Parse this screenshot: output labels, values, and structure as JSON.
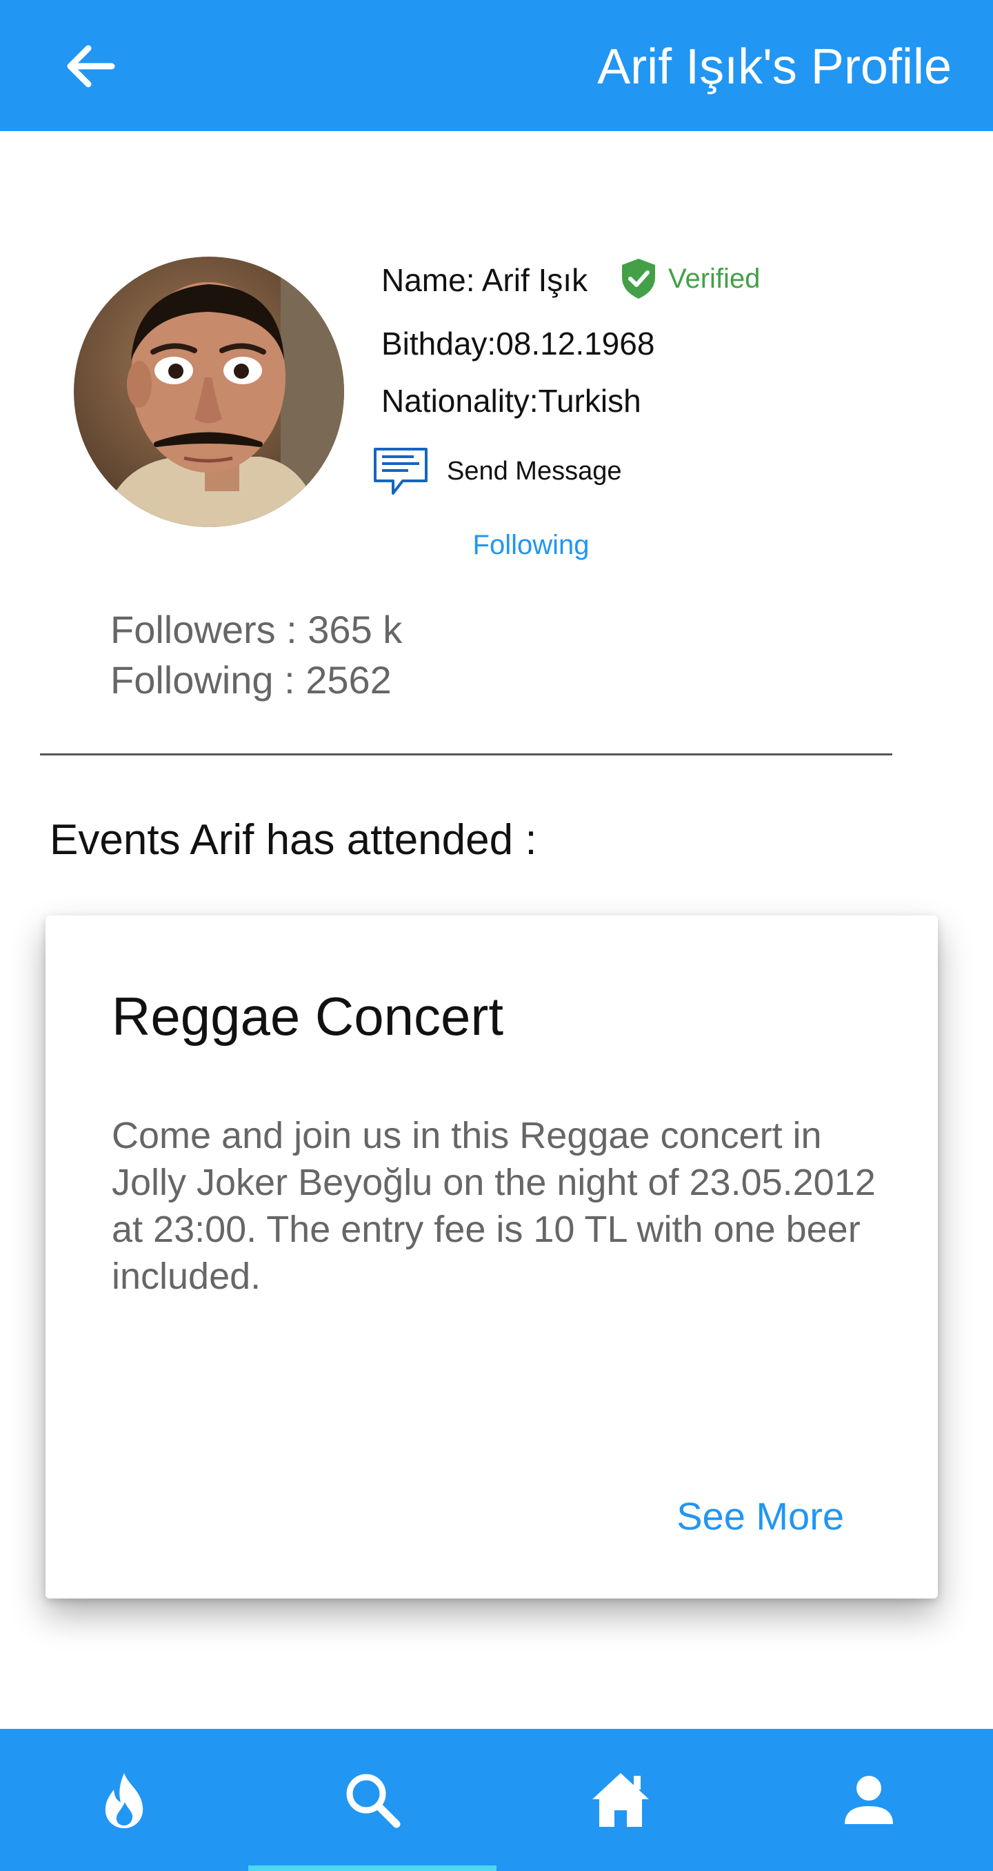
{
  "header": {
    "title": "Arif Işık's Profile",
    "back_icon": "arrow-left-icon"
  },
  "profile": {
    "name_line": "Name: Arif Işık",
    "verified_label": "Verified",
    "birthday_line": "Bithday:08.12.1968",
    "nationality_line": "Nationality:Turkish",
    "send_message_label": "Send Message",
    "following_button": "Following",
    "followers_line": "Followers : 365 k",
    "following_line": "Following : 2562"
  },
  "events": {
    "section_title": "Events Arif has attended :",
    "items": [
      {
        "title": "Reggae Concert",
        "description": "Come and join us in this Reggae concert in Jolly Joker Beyoğlu on the night of 23.05.2012 at 23:00. The entry fee is 10 TL with one beer included.",
        "see_more": "See More"
      }
    ]
  },
  "bottom_nav": {
    "items": [
      {
        "icon": "flame-icon"
      },
      {
        "icon": "search-icon",
        "selected": true
      },
      {
        "icon": "home-icon"
      },
      {
        "icon": "person-icon"
      }
    ]
  },
  "colors": {
    "primary": "#2196f3",
    "verified": "#43a047",
    "indicator": "#4dd8f0",
    "secondary_text": "#666666"
  }
}
